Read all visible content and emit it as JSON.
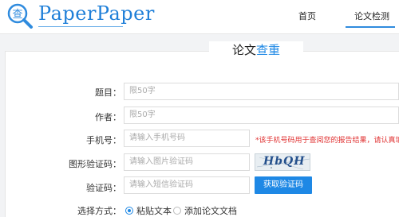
{
  "header": {
    "brand": "PaperPaper",
    "logo_char": "查",
    "nav": [
      {
        "label": "首页"
      },
      {
        "label": "论文检测"
      }
    ]
  },
  "form": {
    "title_part1": "论文",
    "title_part2": "查重",
    "title_part2_color": "#1e88e5",
    "fields": {
      "title": {
        "label": "题目：",
        "placeholder": "限50字"
      },
      "author": {
        "label": "作者：",
        "placeholder": "限50字"
      },
      "phone": {
        "label": "手机号：",
        "placeholder": "请输入手机号码",
        "hint": "*该手机号码用于查阅您的报告结果，请认真填写"
      },
      "image_code": {
        "label": "图形验证码：",
        "placeholder": "请输入图片验证码",
        "captcha": "HbQH"
      },
      "sms_code": {
        "label": "验证码：",
        "placeholder": "请输入短信验证码",
        "button": "获取验证码"
      },
      "method": {
        "label": "选择方式：",
        "options": [
          "粘贴文本",
          "添加论文文档"
        ],
        "selected": "粘贴文本"
      }
    }
  },
  "colors": {
    "accent": "#1e88e5",
    "hint": "#e03030",
    "brand": "#1f7fd8"
  }
}
